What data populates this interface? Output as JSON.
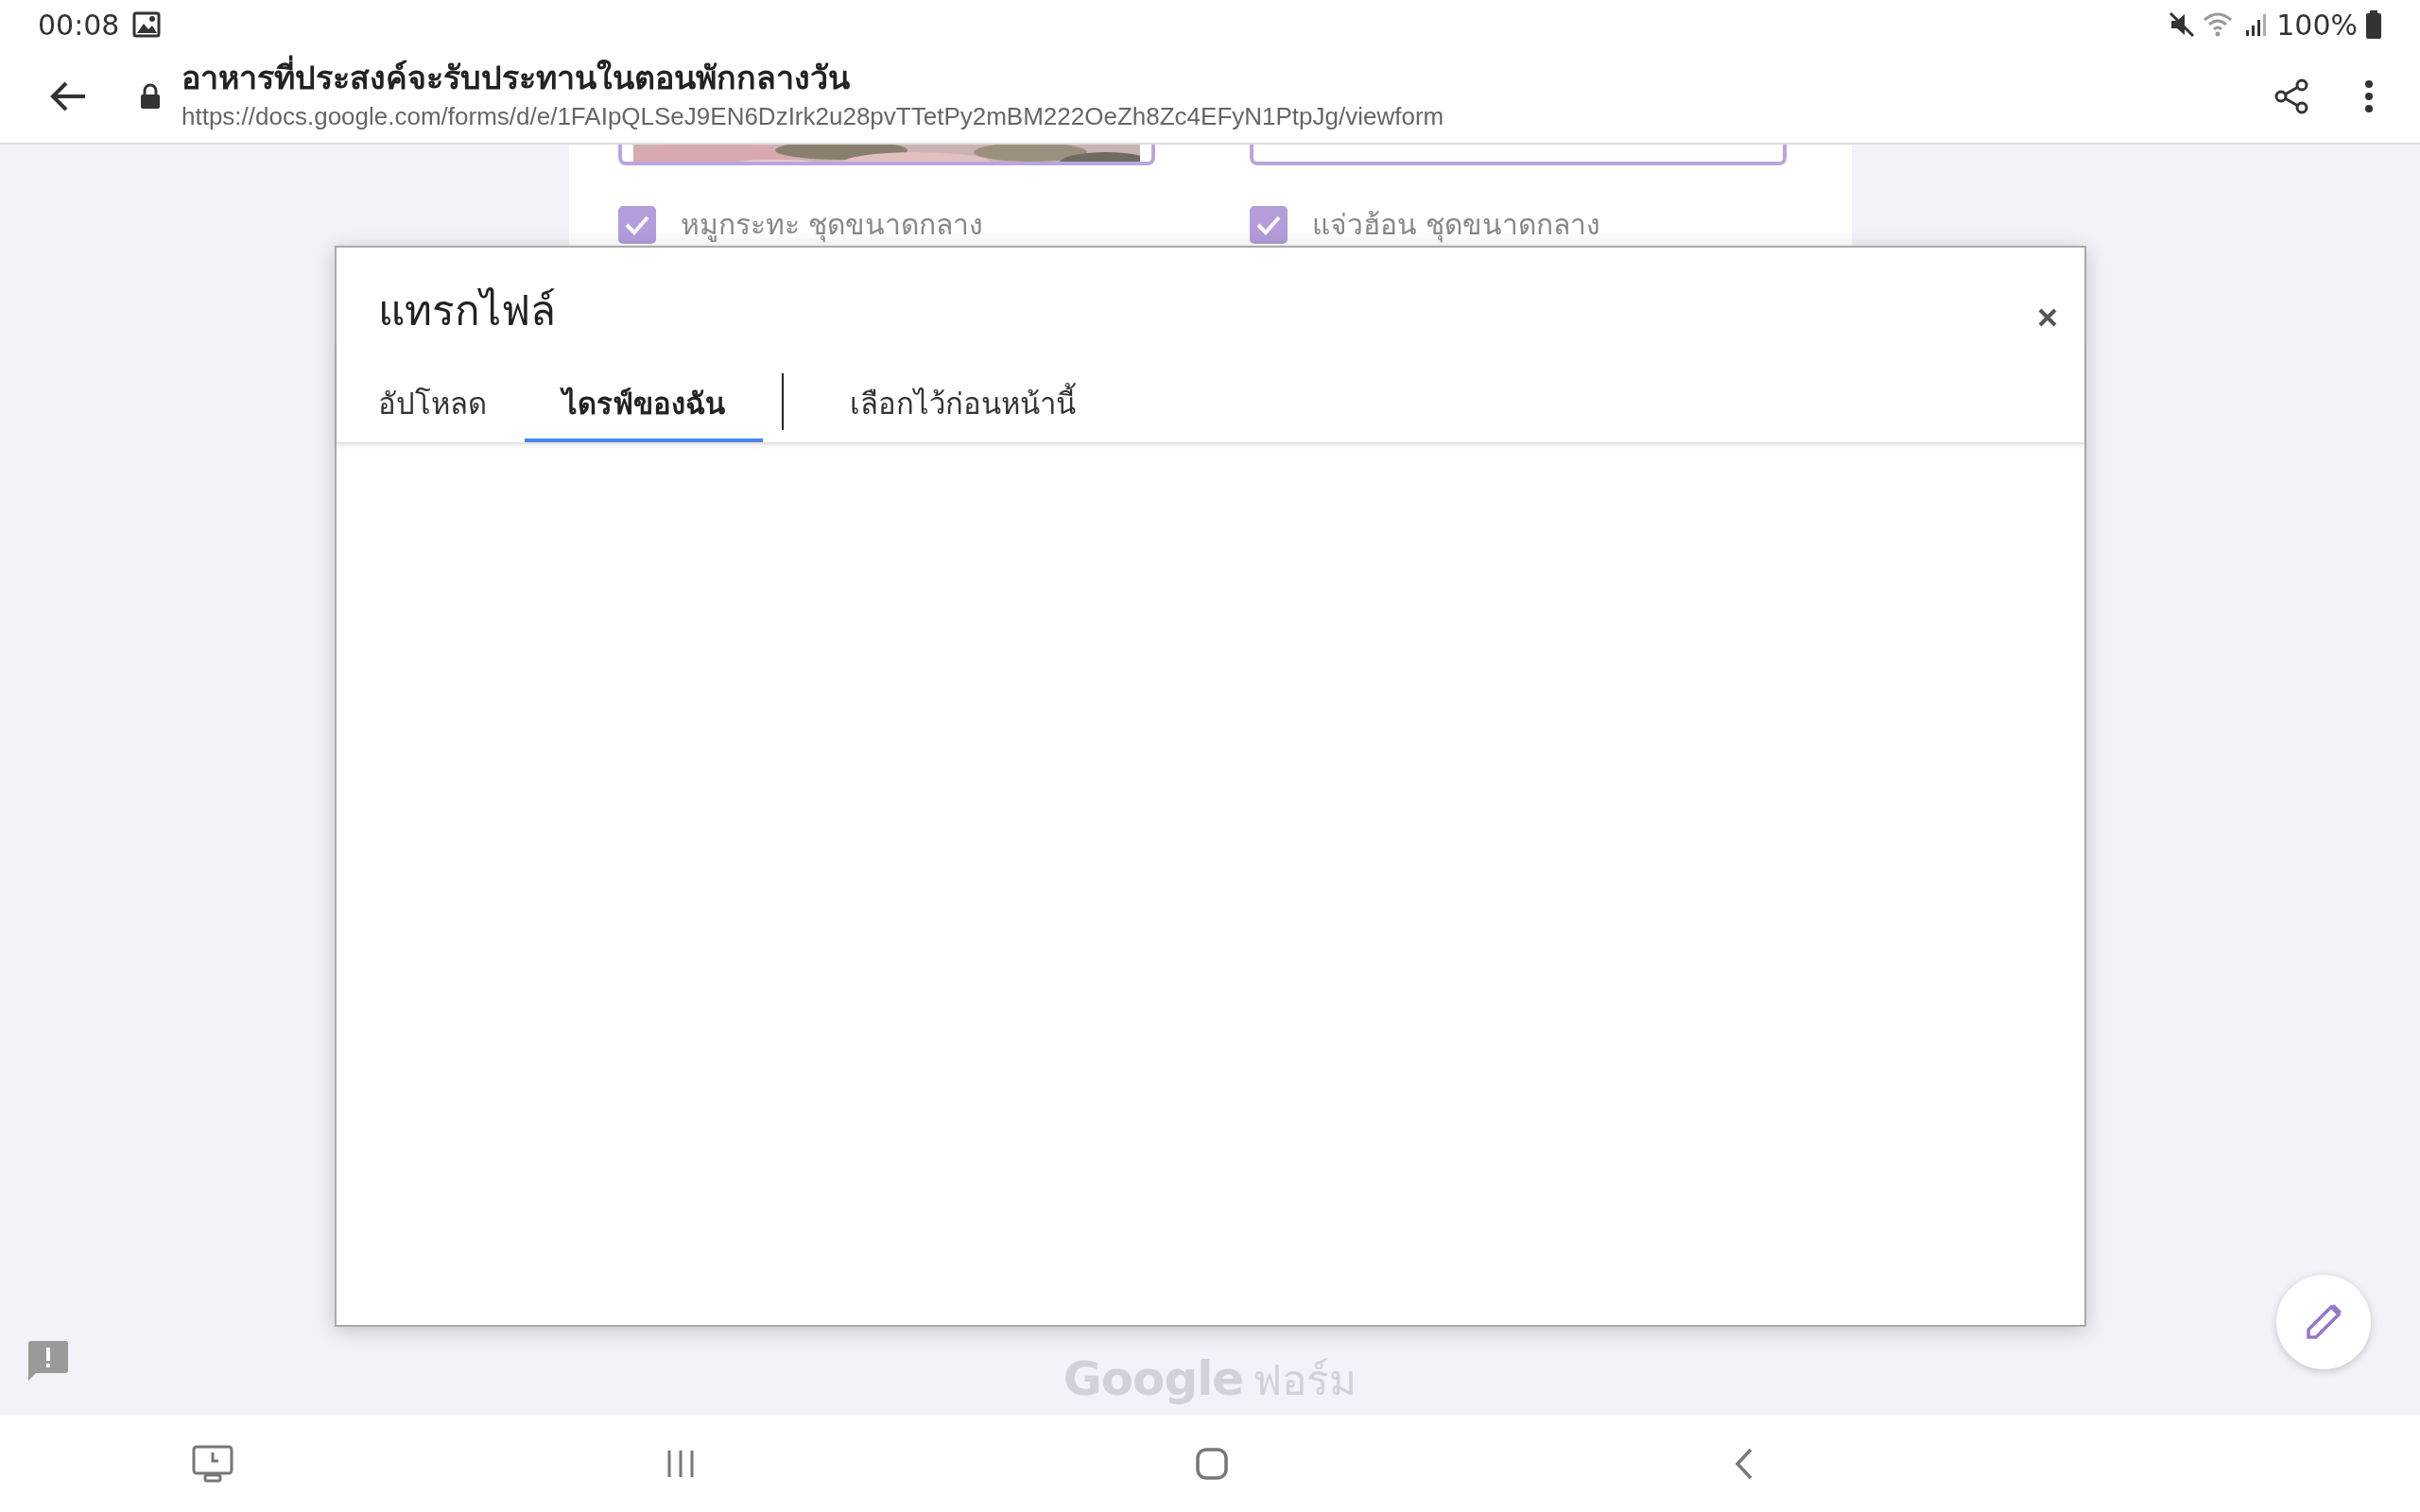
{
  "status_bar": {
    "time": "00:08",
    "battery": "100%"
  },
  "browser": {
    "title": "อาหารที่ประสงค์จะรับประทานในตอนพักกลางวัน",
    "url": "https://docs.google.com/forms/d/e/1FAIpQLSeJ9EN6DzIrk2u28pvTTetPy2mBM222OeZh8Zc4EFyN1PtpJg/viewform"
  },
  "form_behind": {
    "options": [
      {
        "label": "หมูกระทะ ชุดขนาดกลาง",
        "checked": true
      },
      {
        "label": "แจ่วฮ้อน ชุดขนาดกลาง",
        "checked": true
      }
    ]
  },
  "dialog": {
    "title": "แทรกไฟล์",
    "tabs": [
      {
        "label": "อัปโหลด",
        "selected": false
      },
      {
        "label": "ไดรฟ์ของฉัน",
        "selected": true
      },
      {
        "label": "เลือกไว้ก่อนหน้านี้",
        "selected": false
      }
    ]
  },
  "footer": {
    "brand": "Google",
    "product": "ฟอร์ม"
  }
}
